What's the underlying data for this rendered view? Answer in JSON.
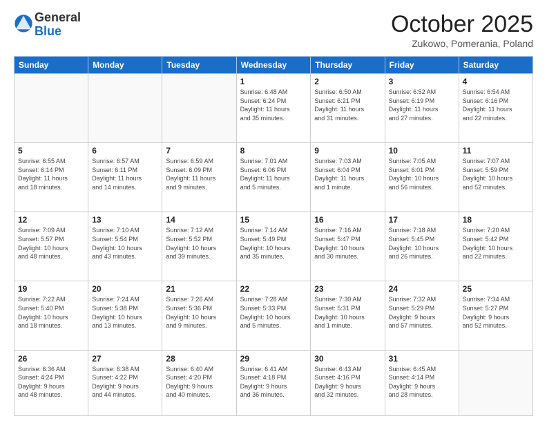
{
  "logo": {
    "general": "General",
    "blue": "Blue"
  },
  "header": {
    "month": "October 2025",
    "location": "Zukowo, Pomerania, Poland"
  },
  "days_of_week": [
    "Sunday",
    "Monday",
    "Tuesday",
    "Wednesday",
    "Thursday",
    "Friday",
    "Saturday"
  ],
  "weeks": [
    [
      {
        "day": "",
        "info": ""
      },
      {
        "day": "",
        "info": ""
      },
      {
        "day": "",
        "info": ""
      },
      {
        "day": "1",
        "info": "Sunrise: 6:48 AM\nSunset: 6:24 PM\nDaylight: 11 hours\nand 35 minutes."
      },
      {
        "day": "2",
        "info": "Sunrise: 6:50 AM\nSunset: 6:21 PM\nDaylight: 11 hours\nand 31 minutes."
      },
      {
        "day": "3",
        "info": "Sunrise: 6:52 AM\nSunset: 6:19 PM\nDaylight: 11 hours\nand 27 minutes."
      },
      {
        "day": "4",
        "info": "Sunrise: 6:54 AM\nSunset: 6:16 PM\nDaylight: 11 hours\nand 22 minutes."
      }
    ],
    [
      {
        "day": "5",
        "info": "Sunrise: 6:55 AM\nSunset: 6:14 PM\nDaylight: 11 hours\nand 18 minutes."
      },
      {
        "day": "6",
        "info": "Sunrise: 6:57 AM\nSunset: 6:11 PM\nDaylight: 11 hours\nand 14 minutes."
      },
      {
        "day": "7",
        "info": "Sunrise: 6:59 AM\nSunset: 6:09 PM\nDaylight: 11 hours\nand 9 minutes."
      },
      {
        "day": "8",
        "info": "Sunrise: 7:01 AM\nSunset: 6:06 PM\nDaylight: 11 hours\nand 5 minutes."
      },
      {
        "day": "9",
        "info": "Sunrise: 7:03 AM\nSunset: 6:04 PM\nDaylight: 11 hours\nand 1 minute."
      },
      {
        "day": "10",
        "info": "Sunrise: 7:05 AM\nSunset: 6:01 PM\nDaylight: 10 hours\nand 56 minutes."
      },
      {
        "day": "11",
        "info": "Sunrise: 7:07 AM\nSunset: 5:59 PM\nDaylight: 10 hours\nand 52 minutes."
      }
    ],
    [
      {
        "day": "12",
        "info": "Sunrise: 7:09 AM\nSunset: 5:57 PM\nDaylight: 10 hours\nand 48 minutes."
      },
      {
        "day": "13",
        "info": "Sunrise: 7:10 AM\nSunset: 5:54 PM\nDaylight: 10 hours\nand 43 minutes."
      },
      {
        "day": "14",
        "info": "Sunrise: 7:12 AM\nSunset: 5:52 PM\nDaylight: 10 hours\nand 39 minutes."
      },
      {
        "day": "15",
        "info": "Sunrise: 7:14 AM\nSunset: 5:49 PM\nDaylight: 10 hours\nand 35 minutes."
      },
      {
        "day": "16",
        "info": "Sunrise: 7:16 AM\nSunset: 5:47 PM\nDaylight: 10 hours\nand 30 minutes."
      },
      {
        "day": "17",
        "info": "Sunrise: 7:18 AM\nSunset: 5:45 PM\nDaylight: 10 hours\nand 26 minutes."
      },
      {
        "day": "18",
        "info": "Sunrise: 7:20 AM\nSunset: 5:42 PM\nDaylight: 10 hours\nand 22 minutes."
      }
    ],
    [
      {
        "day": "19",
        "info": "Sunrise: 7:22 AM\nSunset: 5:40 PM\nDaylight: 10 hours\nand 18 minutes."
      },
      {
        "day": "20",
        "info": "Sunrise: 7:24 AM\nSunset: 5:38 PM\nDaylight: 10 hours\nand 13 minutes."
      },
      {
        "day": "21",
        "info": "Sunrise: 7:26 AM\nSunset: 5:36 PM\nDaylight: 10 hours\nand 9 minutes."
      },
      {
        "day": "22",
        "info": "Sunrise: 7:28 AM\nSunset: 5:33 PM\nDaylight: 10 hours\nand 5 minutes."
      },
      {
        "day": "23",
        "info": "Sunrise: 7:30 AM\nSunset: 5:31 PM\nDaylight: 10 hours\nand 1 minute."
      },
      {
        "day": "24",
        "info": "Sunrise: 7:32 AM\nSunset: 5:29 PM\nDaylight: 9 hours\nand 57 minutes."
      },
      {
        "day": "25",
        "info": "Sunrise: 7:34 AM\nSunset: 5:27 PM\nDaylight: 9 hours\nand 52 minutes."
      }
    ],
    [
      {
        "day": "26",
        "info": "Sunrise: 6:36 AM\nSunset: 4:24 PM\nDaylight: 9 hours\nand 48 minutes."
      },
      {
        "day": "27",
        "info": "Sunrise: 6:38 AM\nSunset: 4:22 PM\nDaylight: 9 hours\nand 44 minutes."
      },
      {
        "day": "28",
        "info": "Sunrise: 6:40 AM\nSunset: 4:20 PM\nDaylight: 9 hours\nand 40 minutes."
      },
      {
        "day": "29",
        "info": "Sunrise: 6:41 AM\nSunset: 4:18 PM\nDaylight: 9 hours\nand 36 minutes."
      },
      {
        "day": "30",
        "info": "Sunrise: 6:43 AM\nSunset: 4:16 PM\nDaylight: 9 hours\nand 32 minutes."
      },
      {
        "day": "31",
        "info": "Sunrise: 6:45 AM\nSunset: 4:14 PM\nDaylight: 9 hours\nand 28 minutes."
      },
      {
        "day": "",
        "info": ""
      }
    ]
  ]
}
